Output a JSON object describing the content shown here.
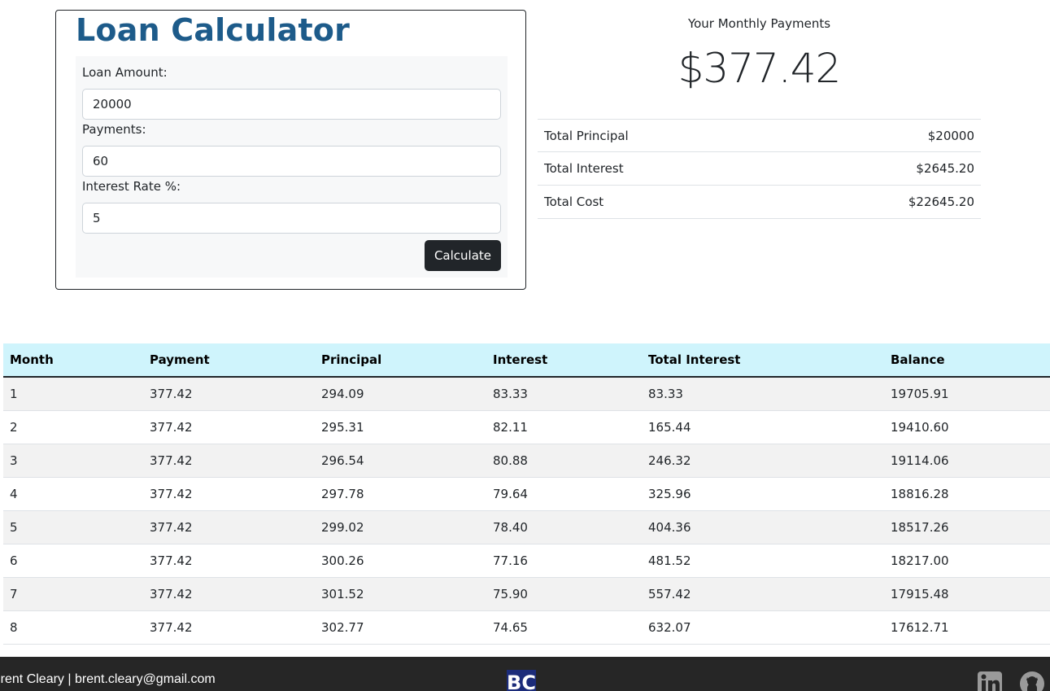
{
  "calculator": {
    "title": "Loan Calculator",
    "loan_amount_label": "Loan Amount:",
    "loan_amount_value": "20000",
    "payments_label": "Payments:",
    "payments_value": "60",
    "interest_rate_label": "Interest Rate %:",
    "interest_rate_value": "5",
    "calculate_label": "Calculate"
  },
  "results": {
    "heading": "Your Monthly Payments",
    "monthly_payment": "$377.42",
    "summary": [
      {
        "label": "Total Principal",
        "value": "$20000"
      },
      {
        "label": "Total Interest",
        "value": "$2645.20"
      },
      {
        "label": "Total Cost",
        "value": "$22645.20"
      }
    ]
  },
  "schedule": {
    "headers": [
      "Month",
      "Payment",
      "Principal",
      "Interest",
      "Total Interest",
      "Balance"
    ],
    "rows": [
      [
        "1",
        "377.42",
        "294.09",
        "83.33",
        "83.33",
        "19705.91"
      ],
      [
        "2",
        "377.42",
        "295.31",
        "82.11",
        "165.44",
        "19410.60"
      ],
      [
        "3",
        "377.42",
        "296.54",
        "80.88",
        "246.32",
        "19114.06"
      ],
      [
        "4",
        "377.42",
        "297.78",
        "79.64",
        "325.96",
        "18816.28"
      ],
      [
        "5",
        "377.42",
        "299.02",
        "78.40",
        "404.36",
        "18517.26"
      ],
      [
        "6",
        "377.42",
        "300.26",
        "77.16",
        "481.52",
        "18217.00"
      ],
      [
        "7",
        "377.42",
        "301.52",
        "75.90",
        "557.42",
        "17915.48"
      ],
      [
        "8",
        "377.42",
        "302.77",
        "74.65",
        "632.07",
        "17612.71"
      ]
    ]
  },
  "footer": {
    "credit": "Brent Cleary | brent.cleary@gmail.com",
    "logo_text": "BC",
    "icons": [
      "linkedin-icon",
      "github-icon"
    ]
  },
  "colors": {
    "title": "#1d5b8a",
    "button": "#212529",
    "table_header": "#cff4fc",
    "footer": "#262626",
    "logo": "#1c2c7a"
  }
}
